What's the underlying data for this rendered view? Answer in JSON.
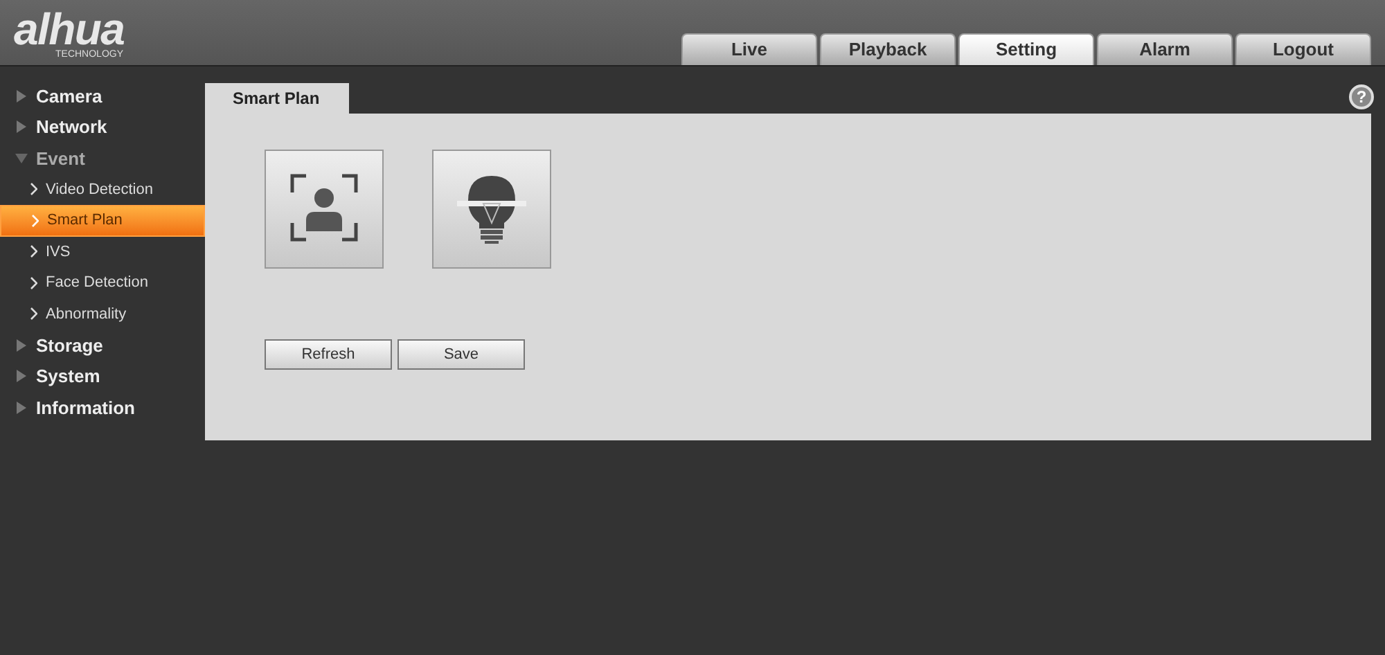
{
  "logo": {
    "brand": "alhua",
    "tagline": "TECHNOLOGY"
  },
  "nav_tabs": [
    {
      "label": "Live",
      "selected": false
    },
    {
      "label": "Playback",
      "selected": false
    },
    {
      "label": "Setting",
      "selected": true
    },
    {
      "label": "Alarm",
      "selected": false
    },
    {
      "label": "Logout",
      "selected": false
    }
  ],
  "sidebar": {
    "items": [
      {
        "label": "Camera",
        "expanded": false
      },
      {
        "label": "Network",
        "expanded": false
      },
      {
        "label": "Event",
        "expanded": true,
        "children": [
          {
            "label": "Video Detection",
            "selected": false
          },
          {
            "label": "Smart Plan",
            "selected": true
          },
          {
            "label": "IVS",
            "selected": false
          },
          {
            "label": "Face Detection",
            "selected": false
          },
          {
            "label": "Abnormality",
            "selected": false
          }
        ]
      },
      {
        "label": "Storage",
        "expanded": false
      },
      {
        "label": "System",
        "expanded": false
      },
      {
        "label": "Information",
        "expanded": false
      }
    ]
  },
  "panel": {
    "tab": "Smart Plan",
    "help": "?",
    "tiles": [
      {
        "kind": "face"
      },
      {
        "kind": "bulb"
      }
    ],
    "buttons": [
      "Refresh",
      "Save"
    ]
  }
}
